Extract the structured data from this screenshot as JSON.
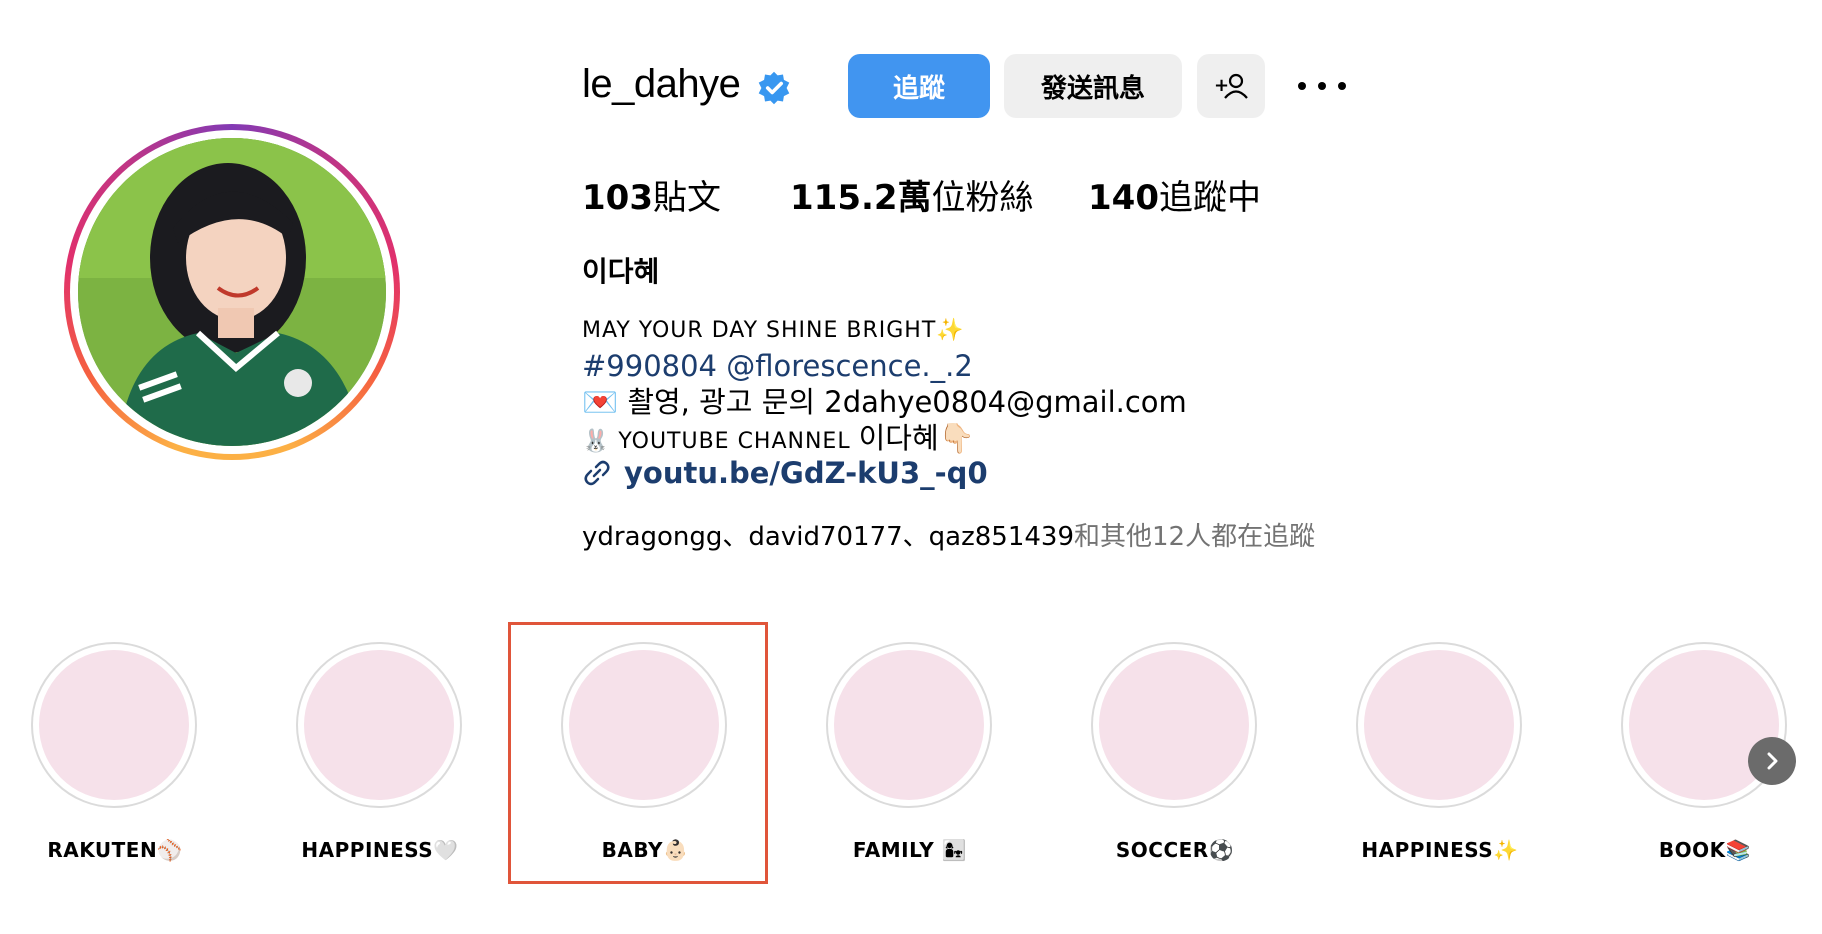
{
  "profile": {
    "username": "le_dahye",
    "follow_label": "追蹤",
    "message_label": "發送訊息",
    "add_user_label": "+",
    "stats": {
      "posts_count": "103",
      "posts_label": "貼文",
      "followers_count": "115.2萬",
      "followers_label": "位粉絲",
      "following_count": "140",
      "following_label": "追蹤中"
    },
    "full_name": "이다혜",
    "bio": {
      "line1": "MAY YOUR DAY SHINE BRIGHT✨",
      "line2": "#990804 @florescence._.2",
      "line3": "💌 촬영, 광고 문의 2dahye0804@gmail.com",
      "line4_prefix": "🐰 YOUTUBE CHANNEL ",
      "line4_suffix": "이다혜👇🏻",
      "link": "youtu.be/GdZ-kU3_-q0"
    },
    "followed_by": {
      "names": "ydragongg、david70177、qaz851439",
      "suffix": "和其他12人都在追蹤"
    }
  },
  "highlights": [
    {
      "label": "RAKUTEN⚾"
    },
    {
      "label": "HAPPINESS🤍"
    },
    {
      "label": "BABY👶🏻"
    },
    {
      "label": "FAMILY 👩‍👧"
    },
    {
      "label": "SOCCER⚽"
    },
    {
      "label": "HAPPINESS✨"
    },
    {
      "label": "BOOK📚"
    }
  ],
  "colors": {
    "accent": "#4195f0",
    "link": "#1c3d6e",
    "highlight_fill": "#f6e1ea",
    "selection_box": "#e0553a"
  },
  "icons": {
    "verified": "verified-badge-icon",
    "add_user": "add-user-icon",
    "more": "more-options-icon",
    "link": "link-icon",
    "next": "chevron-right-icon"
  }
}
